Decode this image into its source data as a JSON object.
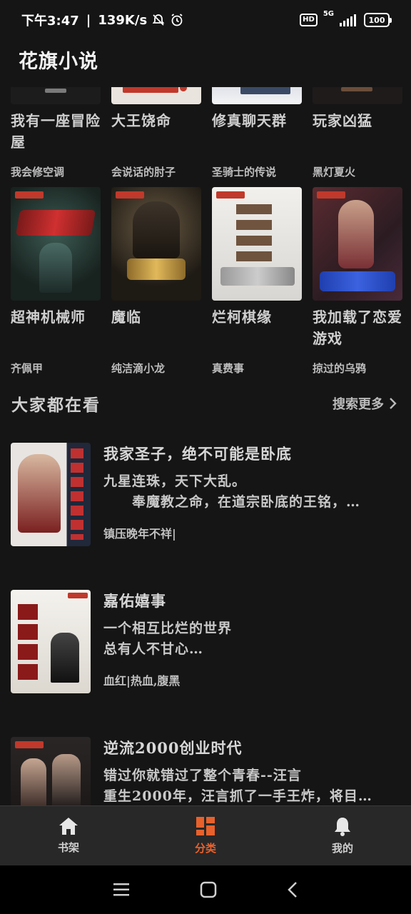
{
  "status_bar": {
    "time": "下午3:47",
    "net_speed": "139K/s",
    "network": "5G",
    "battery": "100"
  },
  "app": {
    "title": "花旗小说"
  },
  "grid_row1": [
    {
      "title": "我有一座冒险屋",
      "author": "我会修空调"
    },
    {
      "title": "大王饶命",
      "author": "会说话的肘子"
    },
    {
      "title": "修真聊天群",
      "author": "圣骑士的传说"
    },
    {
      "title": "玩家凶猛",
      "author": "黑灯夏火"
    }
  ],
  "grid_row2": [
    {
      "title": "超神机械师",
      "author": "齐佩甲"
    },
    {
      "title": "魔临",
      "author": "纯洁滴小龙"
    },
    {
      "title": "烂柯棋缘",
      "author": "真费事"
    },
    {
      "title": "我加载了恋爱游戏",
      "author": "掠过的乌鸦"
    }
  ],
  "section": {
    "title": "大家都在看",
    "more": "搜索更多"
  },
  "list": [
    {
      "title": "我家圣子，绝不可能是卧底",
      "desc": "九星连珠，天下大乱。\n　　奉魔教之命，在道宗卧底的王铭，…",
      "tag": "镇压晚年不祥|"
    },
    {
      "title": "嘉佑嬉事",
      "desc": "一个相互比烂的世界\n总有人不甘心…",
      "tag": "血红|热血,腹黑"
    },
    {
      "title": "逆流2000创业时代",
      "desc": "错过你就错过了整个青春--汪言\n重生2000年，汪言抓了一手王炸，将目…",
      "tag": ""
    }
  ],
  "nav": {
    "shelf": "书架",
    "category": "分类",
    "mine": "我的"
  },
  "colors": {
    "accent": "#e8612c",
    "background": "#151515",
    "nav_bg": "#282828"
  }
}
